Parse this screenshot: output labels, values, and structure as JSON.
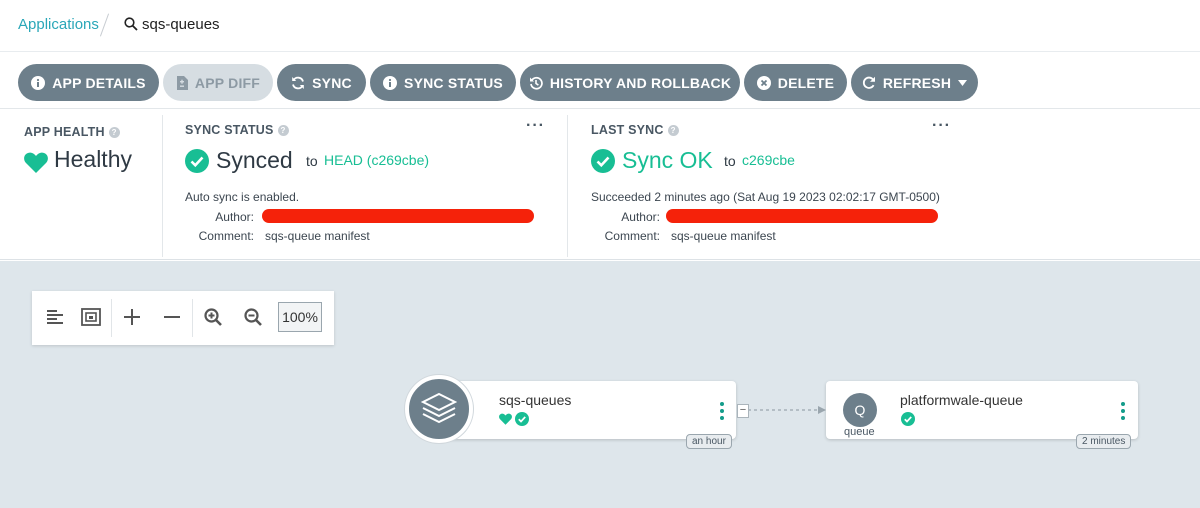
{
  "breadcrumb": {
    "root": "Applications",
    "current": "sqs-queues"
  },
  "toolbar": {
    "app_details": "APP DETAILS",
    "app_diff": "APP DIFF",
    "sync": "SYNC",
    "sync_status": "SYNC STATUS",
    "history": "HISTORY AND ROLLBACK",
    "delete": "DELETE",
    "refresh": "REFRESH"
  },
  "app_health": {
    "title": "APP HEALTH",
    "value": "Healthy"
  },
  "sync_status": {
    "title": "SYNC STATUS",
    "value": "Synced",
    "to_text": "to",
    "revision": "HEAD (c269cbe)",
    "auto_sync": "Auto sync is enabled.",
    "author_label": "Author:",
    "comment_label": "Comment:",
    "comment": "sqs-queue manifest"
  },
  "last_sync": {
    "title": "LAST SYNC",
    "value": "Sync OK",
    "to_text": "to",
    "revision": "c269cbe",
    "succeeded": "Succeeded 2 minutes ago (Sat Aug 19 2023 02:02:17 GMT-0500)",
    "author_label": "Author:",
    "comment_label": "Comment:",
    "comment": "sqs-queue manifest"
  },
  "graph": {
    "zoom": "100%",
    "app_node": {
      "name": "sqs-queues",
      "age": "an hour"
    },
    "queue_node": {
      "name": "platformwale-queue",
      "kind_letter": "Q",
      "kind": "queue",
      "age": "2 minutes"
    }
  },
  "colors": {
    "accent": "#18be94",
    "link": "#2aa7b8",
    "button": "#6d7f8b",
    "canvas": "#dee6eb"
  }
}
